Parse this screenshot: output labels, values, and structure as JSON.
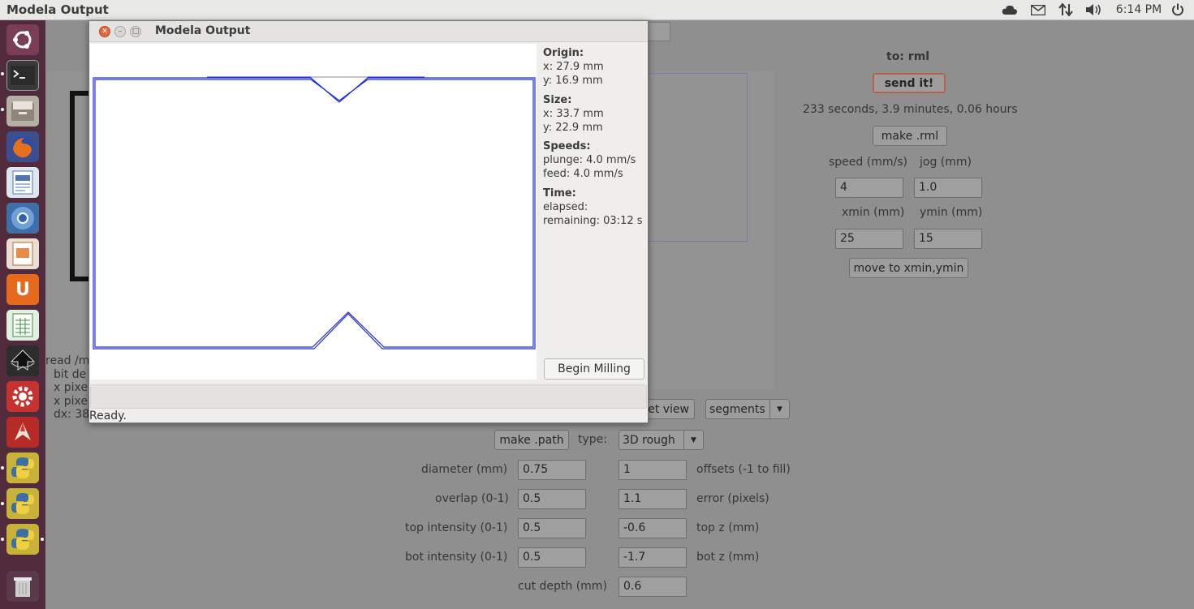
{
  "topbar": {
    "title": "Modela Output",
    "time": "6:14 PM"
  },
  "launcher": {
    "icons": [
      "ubuntu-icon",
      "terminal-icon",
      "files-icon",
      "firefox-icon",
      "writer-icon",
      "chromium-icon",
      "impress-icon",
      "ubuntu-one-icon",
      "calc-icon",
      "inkscape-icon",
      "settings-icon",
      "fab-icon",
      "python-icon",
      "python-icon",
      "python-icon",
      "trash-icon"
    ]
  },
  "right_panel": {
    "to_label": "to: rml",
    "send_label": "send it!",
    "time_estimate": "233 seconds, 3.9 minutes, 0.06 hours",
    "make_rml_label": "make .rml",
    "speed_label": "speed (mm/s)",
    "jog_label": "jog (mm)",
    "speed_value": "4",
    "jog_value": "1.0",
    "xmin_label": "xmin (mm)",
    "ymin_label": "ymin (mm)",
    "xmin_value": "25",
    "ymin_value": "15",
    "move_label": "move to xmin,ymin"
  },
  "left_info": {
    "line1": "read /m",
    "line2": "bit de",
    "line3": "x pixe",
    "line4": "x pixe",
    "line5": "dx: 38"
  },
  "path_panel": {
    "view_label": "et view",
    "segments_value": "segments",
    "make_path_label": "make .path",
    "type_label": "type:",
    "type_value": "3D rough",
    "diameter_label": "diameter (mm)",
    "diameter_value": "0.75",
    "offsets_value": "1",
    "offsets_label": "offsets (-1 to fill)",
    "overlap_label": "overlap (0-1)",
    "overlap_value": "0.5",
    "error_value": "1.1",
    "error_label": "error (pixels)",
    "top_int_label": "top intensity (0-1)",
    "top_int_value": "0.5",
    "top_z_value": "-0.6",
    "top_z_label": "top z (mm)",
    "bot_int_label": "bot intensity (0-1)",
    "bot_int_value": "0.5",
    "bot_z_value": "-1.7",
    "bot_z_label": "bot z (mm)",
    "cut_depth_label": "cut depth (mm)",
    "cut_depth_value": "0.6"
  },
  "dialog": {
    "title": "Modela Output",
    "origin_heading": "Origin:",
    "origin_x": "x: 27.9 mm",
    "origin_y": "y: 16.9 mm",
    "size_heading": "Size:",
    "size_x": "x: 33.7 mm",
    "size_y": "y: 22.9 mm",
    "speeds_heading": "Speeds:",
    "plunge": "plunge: 4.0 mm/s",
    "feed": "feed: 4.0 mm/s",
    "time_heading": "Time:",
    "elapsed": "elapsed:",
    "remaining": "remaining: 03:12 s",
    "begin_label": "Begin Milling",
    "status": "Ready."
  },
  "colors": {
    "toolpath": "#1f2fd6",
    "launcher": "#512a3c",
    "accent": "#dd4814"
  }
}
